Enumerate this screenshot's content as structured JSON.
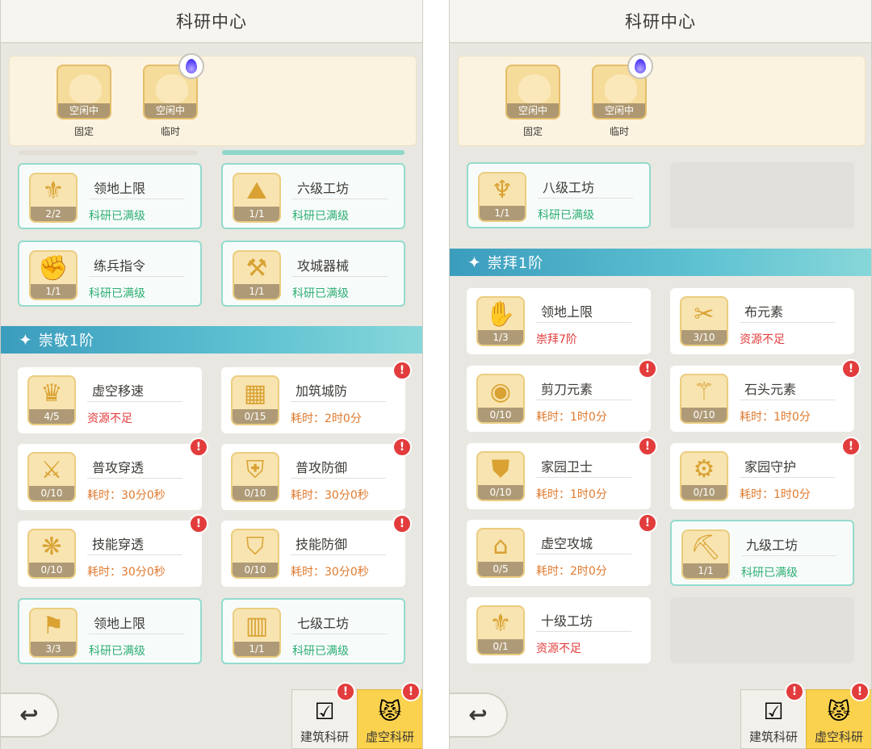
{
  "app": {
    "title": "科研中心"
  },
  "slots": [
    {
      "state": "空闲中",
      "name": "固定",
      "badge": false
    },
    {
      "state": "空闲中",
      "name": "临时",
      "badge": true
    }
  ],
  "tabs": {
    "build": "建筑科研",
    "void": "虚空科研"
  },
  "icons": {
    "back": "back-arrow-icon",
    "flame": "flame-icon",
    "alert": "alert-icon",
    "build_tab": "checklist-icon",
    "void_tab": "demon-mask-icon"
  },
  "colors": {
    "maxed_border": "#93dbcc",
    "banner": "#4fb0c8",
    "status_green": "#2fae73",
    "status_red": "#e23c3c",
    "void_tab": "#fbd24e"
  },
  "left": {
    "section": "崇敬1阶",
    "cards_top": [
      {
        "name": "领地上限",
        "count": "2/2",
        "status": "科研已满级",
        "tone": "green",
        "maxed": true,
        "alert": false
      },
      {
        "name": "六级工坊",
        "count": "1/1",
        "status": "科研已满级",
        "tone": "green",
        "maxed": true,
        "alert": false
      },
      {
        "name": "练兵指令",
        "count": "1/1",
        "status": "科研已满级",
        "tone": "green",
        "maxed": true,
        "alert": false
      },
      {
        "name": "攻城器械",
        "count": "1/1",
        "status": "科研已满级",
        "tone": "green",
        "maxed": true,
        "alert": false
      }
    ],
    "cards_section": [
      {
        "name": "虚空移速",
        "count": "4/5",
        "status": "资源不足",
        "tone": "red",
        "maxed": false,
        "alert": false
      },
      {
        "name": "加筑城防",
        "count": "0/15",
        "status": "耗时：2时0分",
        "tone": "gray",
        "maxed": false,
        "alert": true
      },
      {
        "name": "普攻穿透",
        "count": "0/10",
        "status": "耗时：30分0秒",
        "tone": "gray",
        "maxed": false,
        "alert": true
      },
      {
        "name": "普攻防御",
        "count": "0/10",
        "status": "耗时：30分0秒",
        "tone": "gray",
        "maxed": false,
        "alert": true
      },
      {
        "name": "技能穿透",
        "count": "0/10",
        "status": "耗时：30分0秒",
        "tone": "gray",
        "maxed": false,
        "alert": true
      },
      {
        "name": "技能防御",
        "count": "0/10",
        "status": "耗时：30分0秒",
        "tone": "gray",
        "maxed": false,
        "alert": true
      },
      {
        "name": "领地上限",
        "count": "3/3",
        "status": "科研已满级",
        "tone": "green",
        "maxed": true,
        "alert": false
      },
      {
        "name": "七级工坊",
        "count": "1/1",
        "status": "科研已满级",
        "tone": "green",
        "maxed": true,
        "alert": false
      }
    ]
  },
  "right": {
    "section": "崇拜1阶",
    "cards_top": [
      {
        "name": "八级工坊",
        "count": "1/1",
        "status": "科研已满级",
        "tone": "green",
        "maxed": true,
        "alert": false
      }
    ],
    "cards_section": [
      {
        "name": "领地上限",
        "count": "1/3",
        "status": "崇拜7阶",
        "tone": "red",
        "maxed": false,
        "alert": false
      },
      {
        "name": "布元素",
        "count": "3/10",
        "status": "资源不足",
        "tone": "red",
        "maxed": false,
        "alert": false
      },
      {
        "name": "剪刀元素",
        "count": "0/10",
        "status": "耗时：1时0分",
        "tone": "gray",
        "maxed": false,
        "alert": true
      },
      {
        "name": "石头元素",
        "count": "0/10",
        "status": "耗时：1时0分",
        "tone": "gray",
        "maxed": false,
        "alert": true
      },
      {
        "name": "家园卫士",
        "count": "0/10",
        "status": "耗时：1时0分",
        "tone": "gray",
        "maxed": false,
        "alert": true
      },
      {
        "name": "家园守护",
        "count": "0/10",
        "status": "耗时：1时0分",
        "tone": "gray",
        "maxed": false,
        "alert": true
      },
      {
        "name": "虚空攻城",
        "count": "0/5",
        "status": "耗时：2时0分",
        "tone": "gray",
        "maxed": false,
        "alert": true
      },
      {
        "name": "九级工坊",
        "count": "1/1",
        "status": "科研已满级",
        "tone": "green",
        "maxed": true,
        "alert": false
      },
      {
        "name": "十级工坊",
        "count": "0/1",
        "status": "资源不足",
        "tone": "red",
        "maxed": false,
        "alert": false
      }
    ]
  }
}
